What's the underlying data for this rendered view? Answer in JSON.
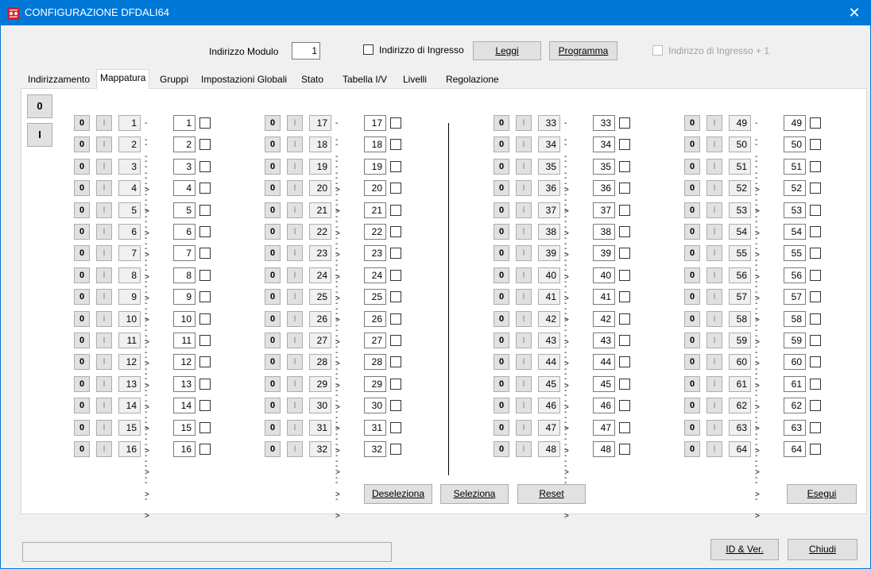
{
  "window": {
    "title": "CONFIGURAZIONE DFDALI64",
    "close_glyph": "✕"
  },
  "header": {
    "module_label": "Indirizzo Modulo",
    "module_value": "1",
    "input_address_label": "Indirizzo di Ingresso",
    "read_button": "Leggi",
    "program_button": "Programma",
    "input_address_plus_label": "Indirizzo di Ingresso + 1"
  },
  "tabs": [
    {
      "label": "Indirizzamento"
    },
    {
      "label": "Mappatura"
    },
    {
      "label": "Gruppi"
    },
    {
      "label": "Impostazioni Globali"
    },
    {
      "label": "Stato"
    },
    {
      "label": "Tabella I/V"
    },
    {
      "label": "Livelli"
    },
    {
      "label": "Regolazione"
    }
  ],
  "active_tab": "Mappatura",
  "side_buttons": {
    "zero": "0",
    "one": "I"
  },
  "row_labels": {
    "zero": "0",
    "one": "I",
    "arrow": "---->"
  },
  "map_rows": [
    {
      "src": "1",
      "dst": "1"
    },
    {
      "src": "2",
      "dst": "2"
    },
    {
      "src": "3",
      "dst": "3"
    },
    {
      "src": "4",
      "dst": "4"
    },
    {
      "src": "5",
      "dst": "5"
    },
    {
      "src": "6",
      "dst": "6"
    },
    {
      "src": "7",
      "dst": "7"
    },
    {
      "src": "8",
      "dst": "8"
    },
    {
      "src": "9",
      "dst": "9"
    },
    {
      "src": "10",
      "dst": "10"
    },
    {
      "src": "11",
      "dst": "11"
    },
    {
      "src": "12",
      "dst": "12"
    },
    {
      "src": "13",
      "dst": "13"
    },
    {
      "src": "14",
      "dst": "14"
    },
    {
      "src": "15",
      "dst": "15"
    },
    {
      "src": "16",
      "dst": "16"
    },
    {
      "src": "17",
      "dst": "17"
    },
    {
      "src": "18",
      "dst": "18"
    },
    {
      "src": "19",
      "dst": "19"
    },
    {
      "src": "20",
      "dst": "20"
    },
    {
      "src": "21",
      "dst": "21"
    },
    {
      "src": "22",
      "dst": "22"
    },
    {
      "src": "23",
      "dst": "23"
    },
    {
      "src": "24",
      "dst": "24"
    },
    {
      "src": "25",
      "dst": "25"
    },
    {
      "src": "26",
      "dst": "26"
    },
    {
      "src": "27",
      "dst": "27"
    },
    {
      "src": "28",
      "dst": "28"
    },
    {
      "src": "29",
      "dst": "29"
    },
    {
      "src": "30",
      "dst": "30"
    },
    {
      "src": "31",
      "dst": "31"
    },
    {
      "src": "32",
      "dst": "32"
    },
    {
      "src": "33",
      "dst": "33"
    },
    {
      "src": "34",
      "dst": "34"
    },
    {
      "src": "35",
      "dst": "35"
    },
    {
      "src": "36",
      "dst": "36"
    },
    {
      "src": "37",
      "dst": "37"
    },
    {
      "src": "38",
      "dst": "38"
    },
    {
      "src": "39",
      "dst": "39"
    },
    {
      "src": "40",
      "dst": "40"
    },
    {
      "src": "41",
      "dst": "41"
    },
    {
      "src": "42",
      "dst": "42"
    },
    {
      "src": "43",
      "dst": "43"
    },
    {
      "src": "44",
      "dst": "44"
    },
    {
      "src": "45",
      "dst": "45"
    },
    {
      "src": "46",
      "dst": "46"
    },
    {
      "src": "47",
      "dst": "47"
    },
    {
      "src": "48",
      "dst": "48"
    },
    {
      "src": "49",
      "dst": "49"
    },
    {
      "src": "50",
      "dst": "50"
    },
    {
      "src": "51",
      "dst": "51"
    },
    {
      "src": "52",
      "dst": "52"
    },
    {
      "src": "53",
      "dst": "53"
    },
    {
      "src": "54",
      "dst": "54"
    },
    {
      "src": "55",
      "dst": "55"
    },
    {
      "src": "56",
      "dst": "56"
    },
    {
      "src": "57",
      "dst": "57"
    },
    {
      "src": "58",
      "dst": "58"
    },
    {
      "src": "59",
      "dst": "59"
    },
    {
      "src": "60",
      "dst": "60"
    },
    {
      "src": "61",
      "dst": "61"
    },
    {
      "src": "62",
      "dst": "62"
    },
    {
      "src": "63",
      "dst": "63"
    },
    {
      "src": "64",
      "dst": "64"
    }
  ],
  "actions": {
    "deselect": "Deseleziona",
    "select": "Seleziona",
    "reset": "Reset",
    "execute": "Esegui"
  },
  "footer": {
    "status_text": "",
    "id_ver_button": "ID & Ver.",
    "close_button": "Chiudi"
  },
  "colors": {
    "titlebar": "#0078d7",
    "window_bg": "#f0f0f0",
    "button_face": "#e1e1e1"
  },
  "icons": {
    "app": "dfdali-app-icon",
    "close": "close-icon"
  }
}
